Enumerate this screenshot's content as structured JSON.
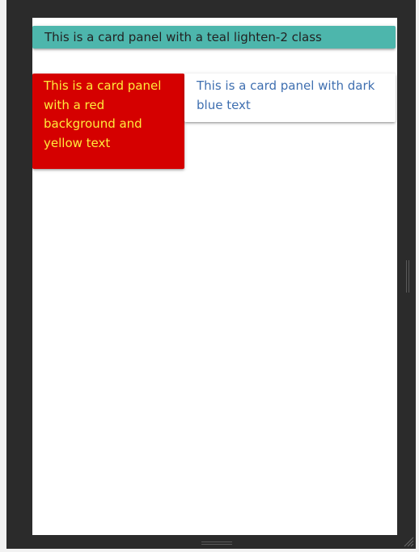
{
  "cards": {
    "teal": {
      "text": "This is a card panel with a teal lighten-2 class",
      "color_class": "teal lighten-2",
      "background": "#4db6ac"
    },
    "red": {
      "text": "This is a card panel with a red background and yellow text",
      "background": "#d50000",
      "text_color": "#ffeb3b"
    },
    "white": {
      "text": "This is a card panel with dark blue text",
      "background": "#ffffff",
      "text_color": "#3f6fb0"
    }
  },
  "window": {
    "frame_color": "#2b2b2b",
    "resize_grip_icon": "resize-grip-icon",
    "side_handle_icon": "drag-handle-icon"
  }
}
